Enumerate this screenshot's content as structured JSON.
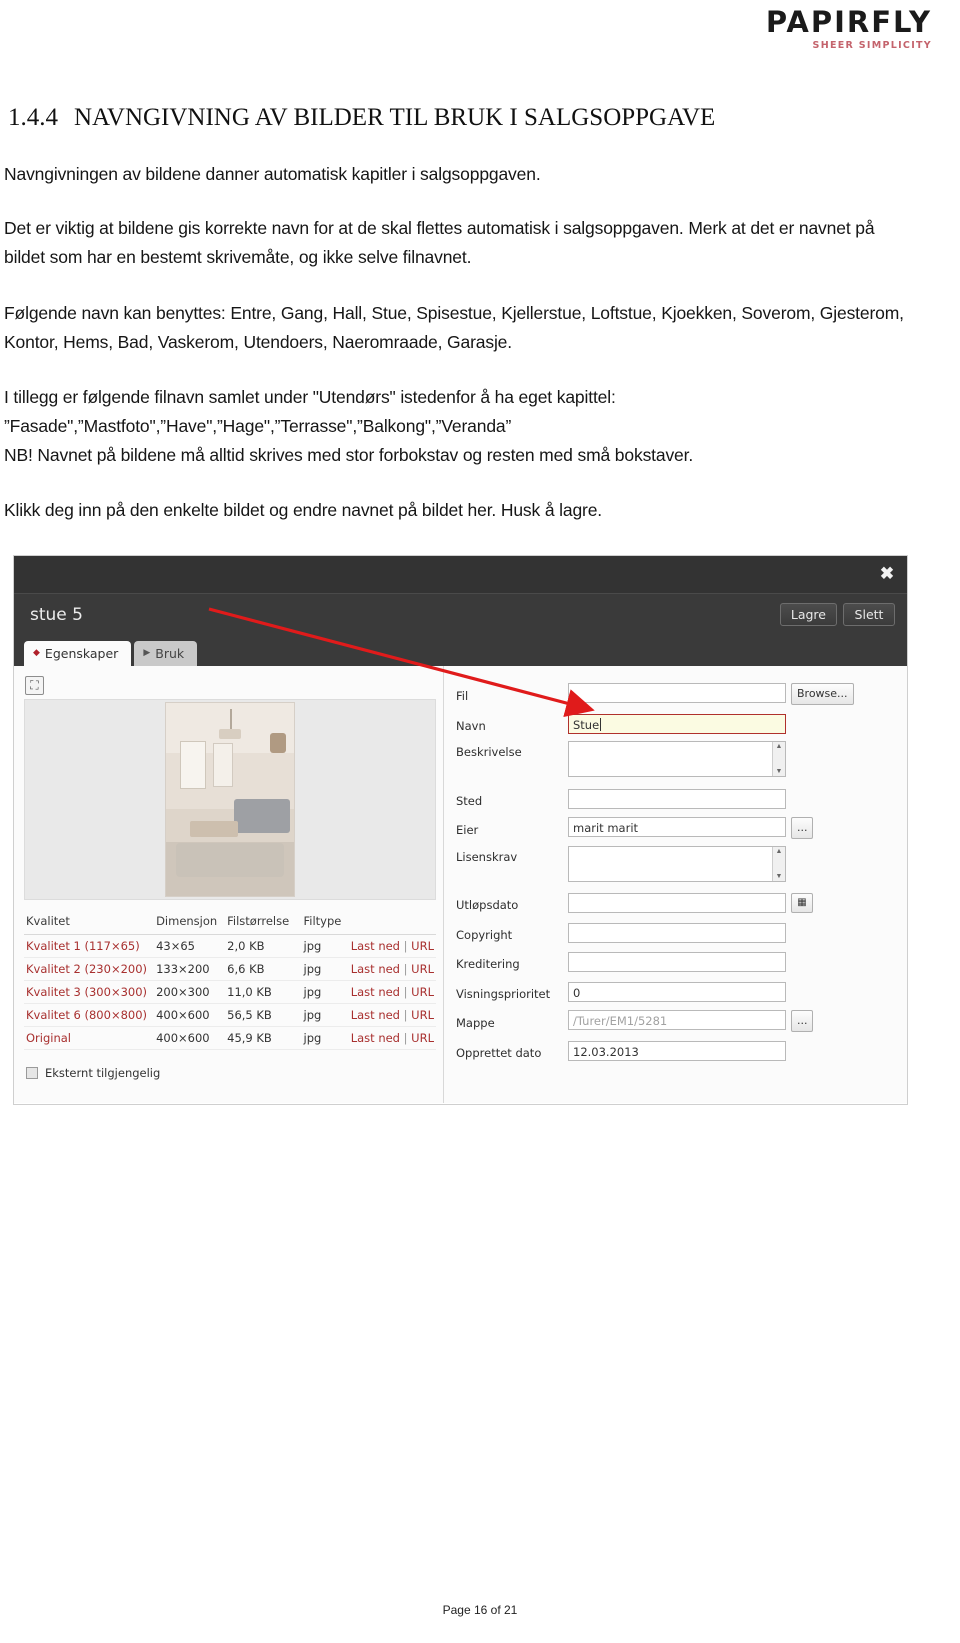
{
  "brand": {
    "name": "PAPIRFLY",
    "tagline": "SHEER SIMPLICITY",
    "tagline_color": "#c4636c"
  },
  "document": {
    "heading_number": "1.4.4",
    "heading_text": "NAVNGIVNING AV BILDER TIL BRUK I SALGSOPPGAVE",
    "paragraphs": [
      "Navngivningen av bildene danner automatisk kapitler i salgsoppgaven.",
      "Det er viktig at bildene gis korrekte navn for at de skal flettes automatisk i salgsoppgaven. Merk at det er navnet på bildet som har en bestemt skrivemåte, og ikke selve filnavnet.",
      "Følgende navn kan benyttes: Entre, Gang, Hall, Stue, Spisestue, Kjellerstue, Loftstue, Kjoekken, Soverom, Gjesterom, Kontor, Hems, Bad, Vaskerom, Utendoers, Naeromraade, Garasje.",
      " I tillegg er følgende filnavn samlet under \"Utendørs\" istedenfor å ha eget kapittel:",
      "”Fasade\",”Mastfoto\",”Have\",”Hage\",”Terrasse\",”Balkong\",”Veranda”",
      "NB! Navnet på bildene må alltid skrives med stor forbokstav og resten med små bokstaver.",
      "Klikk deg inn på den enkelte bildet og endre navnet på bildet her. Husk å lagre."
    ]
  },
  "app": {
    "title": "stue 5",
    "close_icon": "✖",
    "header_buttons": [
      {
        "label": "Lagre"
      },
      {
        "label": "Slett"
      }
    ],
    "tabs": [
      {
        "label": "Egenskaper",
        "icon": "◆",
        "active": true
      },
      {
        "label": "Bruk",
        "icon": "▶",
        "active": false
      }
    ],
    "crop_icon": "⛶",
    "quality_table": {
      "columns": [
        "Kvalitet",
        "Dimensjon",
        "Filstørrelse",
        "Filtype",
        ""
      ],
      "rows": [
        {
          "kvalitet": "Kvalitet 1 (117×65)",
          "dimensjon": "43×65",
          "filstorrelse": "2,0 KB",
          "filtype": "jpg",
          "download": "Last ned",
          "url": "URL"
        },
        {
          "kvalitet": "Kvalitet 2 (230×200)",
          "dimensjon": "133×200",
          "filstorrelse": "6,6 KB",
          "filtype": "jpg",
          "download": "Last ned",
          "url": "URL"
        },
        {
          "kvalitet": "Kvalitet 3 (300×300)",
          "dimensjon": "200×300",
          "filstorrelse": "11,0 KB",
          "filtype": "jpg",
          "download": "Last ned",
          "url": "URL"
        },
        {
          "kvalitet": "Kvalitet 6 (800×800)",
          "dimensjon": "400×600",
          "filstorrelse": "56,5 KB",
          "filtype": "jpg",
          "download": "Last ned",
          "url": "URL"
        },
        {
          "kvalitet": "Original",
          "dimensjon": "400×600",
          "filstorrelse": "45,9 KB",
          "filtype": "jpg",
          "download": "Last ned",
          "url": "URL"
        }
      ],
      "separator": "|"
    },
    "external_checkbox": {
      "label": "Eksternt tilgjengelig",
      "checked": false
    },
    "form": {
      "fil": {
        "label": "Fil",
        "value": "",
        "button": "Browse..."
      },
      "navn": {
        "label": "Navn",
        "value": "Stue"
      },
      "beskrivelse": {
        "label": "Beskrivelse",
        "value": ""
      },
      "sted": {
        "label": "Sted",
        "value": ""
      },
      "eier": {
        "label": "Eier",
        "value": "marit marit",
        "button": "..."
      },
      "lisenskrav": {
        "label": "Lisenskrav",
        "value": ""
      },
      "utlopsdato": {
        "label": "Utløpsdato",
        "value": "",
        "button": "▦"
      },
      "copyright": {
        "label": "Copyright",
        "value": ""
      },
      "kreditering": {
        "label": "Kreditering",
        "value": ""
      },
      "visningsprioritet": {
        "label": "Visningsprioritet",
        "value": "0"
      },
      "mappe": {
        "label": "Mappe",
        "value": "/Turer/EM1/5281",
        "button": "..."
      },
      "opprettet_dato": {
        "label": "Opprettet dato",
        "value": "12.03.2013"
      }
    },
    "annotation_arrow_color": "#e01b1b"
  },
  "footer": {
    "page_label": "Page 16 of 21"
  }
}
